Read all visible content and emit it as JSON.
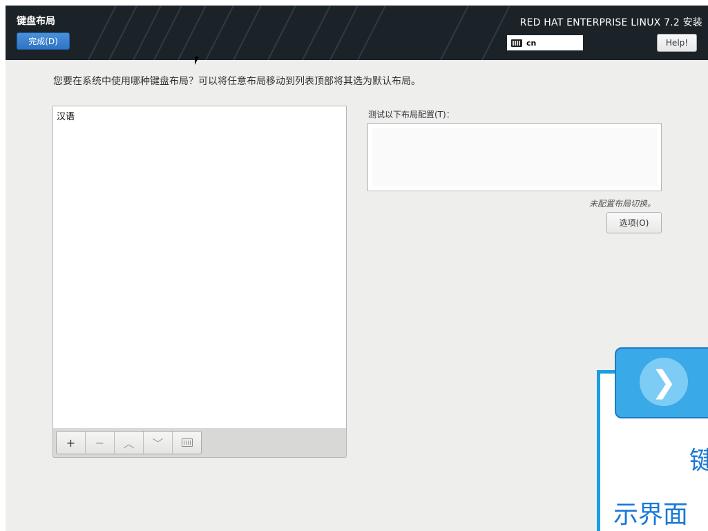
{
  "header": {
    "spoke_title": "键盘布局",
    "done_label": "完成(D)",
    "product_title": "RED HAT ENTERPRISE LINUX 7.2 安装",
    "keyboard_indicator": "cn",
    "help_label": "Help!"
  },
  "main": {
    "instruction": "您要在系统中使用哪种键盘布局？可以将任意布局移动到列表顶部将其选为默认布局。",
    "layouts": [
      "汉语"
    ],
    "toolbar": {
      "add": "+",
      "remove": "−",
      "up": "︿",
      "down": "﹀",
      "preview_icon": "keyboard-icon"
    },
    "test_label": "测试以下布局配置(T)：",
    "test_value": "",
    "switch_note": "未配置布局切换。",
    "options_label": "选项(O)"
  },
  "overlay": {
    "arrow": "❯",
    "text1": "键",
    "text2": "示界面"
  },
  "colors": {
    "header_bg": "#1c2328",
    "done_button": "#3a82d0",
    "overlay_blue": "#39a9e8",
    "overlay_text": "#1a78d6"
  }
}
